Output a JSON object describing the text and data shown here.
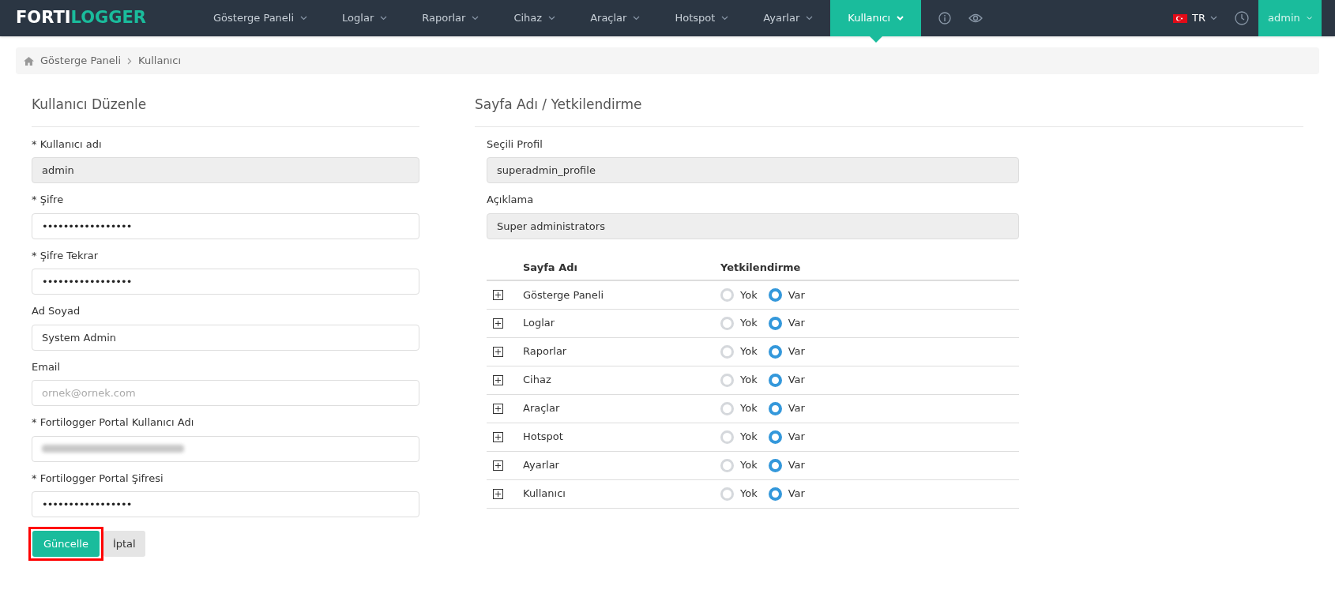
{
  "navbar": {
    "logo": {
      "part_1": "FORTI",
      "part_2": "LOGGER"
    },
    "menu": [
      {
        "label": "Gösterge Paneli",
        "selected": false
      },
      {
        "label": "Loglar",
        "selected": false
      },
      {
        "label": "Raporlar",
        "selected": false
      },
      {
        "label": "Cihaz",
        "selected": false
      },
      {
        "label": "Araçlar",
        "selected": false
      },
      {
        "label": "Hotspot",
        "selected": false
      },
      {
        "label": "Ayarlar",
        "selected": false
      },
      {
        "label": "Kullanıcı",
        "selected": true
      }
    ],
    "language": "TR",
    "user": "admin"
  },
  "breadcrumb": [
    "Gösterge Paneli",
    "Kullanıcı"
  ],
  "user_form": {
    "title": "Kullanıcı Düzenle",
    "fields": [
      {
        "label": "* Kullanıcı adı",
        "kind": "readonly",
        "value": "admin"
      },
      {
        "label": "* Şifre",
        "kind": "password",
        "value": "•••••••••••••••••"
      },
      {
        "label": "* Şifre Tekrar",
        "kind": "password",
        "value": "•••••••••••••••••"
      },
      {
        "label": "Ad Soyad",
        "kind": "text",
        "value": "System Admin"
      },
      {
        "label": "Email",
        "kind": "empty",
        "placeholder": "ornek@ornek.com"
      },
      {
        "label": "* Fortilogger Portal Kullanıcı Adı",
        "kind": "blurred"
      },
      {
        "label": "* Fortilogger Portal Şifresi",
        "kind": "password",
        "value": "•••••••••••••••••"
      }
    ],
    "buttons": [
      {
        "label": "Güncelle",
        "kind": "primary",
        "highlighted": true
      },
      {
        "label": "İptal",
        "kind": "secondary",
        "highlighted": false
      }
    ]
  },
  "permissions": {
    "title": "Sayfa Adı / Yetkilendirme",
    "fields": [
      {
        "label": "Seçili Profil",
        "value": "superadmin_profile"
      },
      {
        "label": "Açıklama",
        "value": "Super administrators"
      }
    ],
    "table": {
      "columns": [
        "Sayfa Adı",
        "Yetkilendirme"
      ],
      "rows": [
        {
          "page": "Gösterge Paneli",
          "options": [
            {
              "label": "Yok",
              "selected": false
            },
            {
              "label": "Var",
              "selected": true
            }
          ]
        },
        {
          "page": "Loglar",
          "options": [
            {
              "label": "Yok",
              "selected": false
            },
            {
              "label": "Var",
              "selected": true
            }
          ]
        },
        {
          "page": "Raporlar",
          "options": [
            {
              "label": "Yok",
              "selected": false
            },
            {
              "label": "Var",
              "selected": true
            }
          ]
        },
        {
          "page": "Cihaz",
          "options": [
            {
              "label": "Yok",
              "selected": false
            },
            {
              "label": "Var",
              "selected": true
            }
          ]
        },
        {
          "page": "Araçlar",
          "options": [
            {
              "label": "Yok",
              "selected": false
            },
            {
              "label": "Var",
              "selected": true
            }
          ]
        },
        {
          "page": "Hotspot",
          "options": [
            {
              "label": "Yok",
              "selected": false
            },
            {
              "label": "Var",
              "selected": true
            }
          ]
        },
        {
          "page": "Ayarlar",
          "options": [
            {
              "label": "Yok",
              "selected": false
            },
            {
              "label": "Var",
              "selected": true
            }
          ]
        },
        {
          "page": "Kullanıcı",
          "options": [
            {
              "label": "Yok",
              "selected": false
            },
            {
              "label": "Var",
              "selected": true
            }
          ]
        }
      ]
    }
  }
}
